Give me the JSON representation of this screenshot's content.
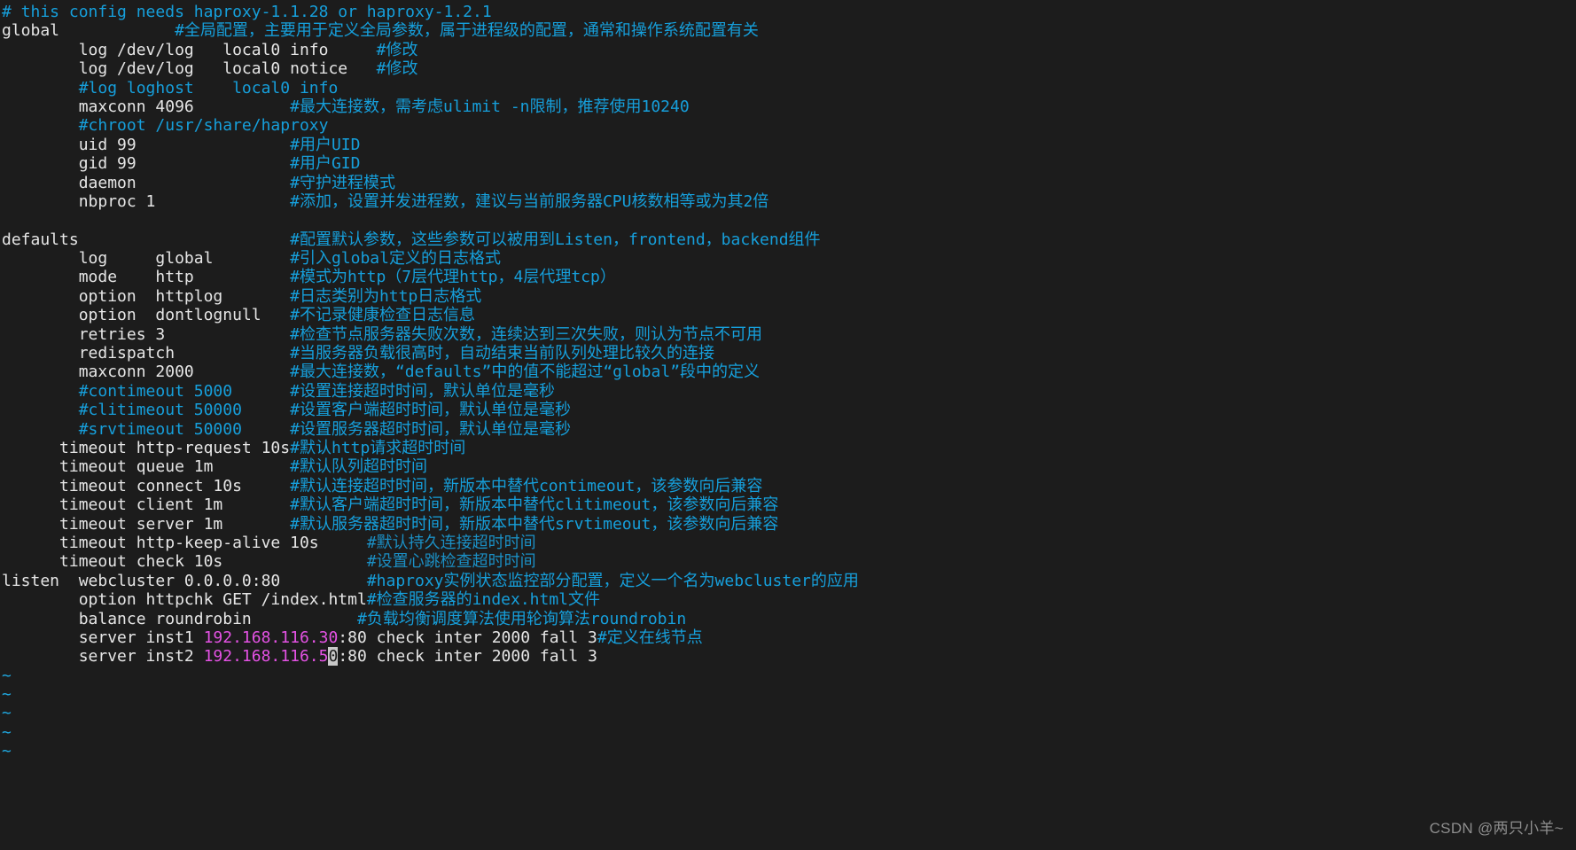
{
  "terminal": {
    "app": "vim",
    "colors": {
      "background": "#1c1c1c",
      "code_text": "#e6e6e6",
      "comment_text": "#169fdb",
      "ip_address": "#e452e4",
      "tilde": "#1fa8e0",
      "cursor_background": "#c8c8c8",
      "watermark": "#8e8e8e"
    },
    "cursor": {
      "line_index": 34,
      "character": "0",
      "on_text": "192.168.116.50"
    },
    "watermark": "CSDN @两只小羊~",
    "lines": [
      {
        "code": "",
        "comment": "# this config needs haproxy-1.1.28 or haproxy-1.2.1",
        "comment_col": 0
      },
      {
        "code": "global",
        "comment": "#全局配置，主要用于定义全局参数，属于进程级的配置，通常和操作系统配置有关",
        "comment_col": 18
      },
      {
        "code": "        log /dev/log   local0 info",
        "comment": "#修改",
        "comment_col": 39
      },
      {
        "code": "        log /dev/log   local0 notice",
        "comment": "#修改",
        "comment_col": 39
      },
      {
        "code": "        #log loghost    local0 info",
        "comment": "",
        "comment_col": 0,
        "code_is_comment": true
      },
      {
        "code": "        maxconn 4096",
        "comment": "#最大连接数，需考虑ulimit -n限制，推荐使用10240",
        "comment_col": 30
      },
      {
        "code": "        #chroot /usr/share/haproxy",
        "comment": "",
        "comment_col": 0,
        "code_is_comment": true
      },
      {
        "code": "        uid 99",
        "comment": "#用户UID",
        "comment_col": 30
      },
      {
        "code": "        gid 99",
        "comment": "#用户GID",
        "comment_col": 30
      },
      {
        "code": "        daemon",
        "comment": "#守护进程模式",
        "comment_col": 30
      },
      {
        "code": "        nbproc 1",
        "comment": "#添加，设置并发进程数，建议与当前服务器CPU核数相等或为其2倍",
        "comment_col": 30
      },
      {
        "code": "",
        "comment": "",
        "comment_col": 0
      },
      {
        "code": "defaults",
        "comment": "#配置默认参数，这些参数可以被用到Listen，frontend，backend组件",
        "comment_col": 30
      },
      {
        "code": "        log     global",
        "comment": "#引入global定义的日志格式",
        "comment_col": 30
      },
      {
        "code": "        mode    http",
        "comment": "#模式为http（7层代理http，4层代理tcp）",
        "comment_col": 30
      },
      {
        "code": "        option  httplog",
        "comment": "#日志类别为http日志格式",
        "comment_col": 30
      },
      {
        "code": "        option  dontlognull",
        "comment": "#不记录健康检查日志信息",
        "comment_col": 30
      },
      {
        "code": "        retries 3",
        "comment": "#检查节点服务器失败次数，连续达到三次失败，则认为节点不可用",
        "comment_col": 30
      },
      {
        "code": "        redispatch",
        "comment": "#当服务器负载很高时，自动结束当前队列处理比较久的连接",
        "comment_col": 30
      },
      {
        "code": "        maxconn 2000",
        "comment": "#最大连接数，“defaults”中的值不能超过“global”段中的定义",
        "comment_col": 30
      },
      {
        "code": "        #contimeout 5000",
        "comment": "#设置连接超时时间，默认单位是毫秒",
        "comment_col": 30,
        "code_is_comment": true
      },
      {
        "code": "        #clitimeout 50000",
        "comment": "#设置客户端超时时间，默认单位是毫秒",
        "comment_col": 30,
        "code_is_comment": true
      },
      {
        "code": "        #srvtimeout 50000",
        "comment": "#设置服务器超时时间，默认单位是毫秒",
        "comment_col": 30,
        "code_is_comment": true
      },
      {
        "code": "      timeout http-request 10s",
        "comment": "#默认http请求超时时间",
        "comment_col": 30
      },
      {
        "code": "      timeout queue 1m",
        "comment": "#默认队列超时时间",
        "comment_col": 30
      },
      {
        "code": "      timeout connect 10s",
        "comment": "#默认连接超时时间，新版本中替代contimeout，该参数向后兼容",
        "comment_col": 30
      },
      {
        "code": "      timeout client 1m",
        "comment": "#默认客户端超时时间，新版本中替代clitimeout，该参数向后兼容",
        "comment_col": 30
      },
      {
        "code": "      timeout server 1m",
        "comment": "#默认服务器超时时间，新版本中替代srvtimeout，该参数向后兼容",
        "comment_col": 30
      },
      {
        "code": "      timeout http-keep-alive 10s",
        "comment": "#默认持久连接超时时间",
        "comment_col": 38,
        "comment_dim": true
      },
      {
        "code": "      timeout check 10s",
        "comment": "#设置心跳检查超时时间",
        "comment_col": 38,
        "comment_dim": true
      },
      {
        "code": "listen  webcluster 0.0.0.0:80",
        "comment": "#haproxy实例状态监控部分配置，定义一个名为webcluster的应用",
        "comment_col": 38
      },
      {
        "code": "        option httpchk GET /index.html",
        "comment": "#检查服务器的index.html文件",
        "comment_col": 38
      },
      {
        "code": "        balance roundrobin",
        "comment": "#负载均衡调度算法使用轮询算法roundrobin",
        "comment_col": 37
      },
      {
        "code": "        server inst1 192.168.116.30:80 check inter 2000 fall 3",
        "comment": "#定义在线节点",
        "comment_col": 62,
        "ip": "192.168.116.30"
      },
      {
        "code": "        server inst2 192.168.116.50:80 check inter 2000 fall 3",
        "comment": "",
        "comment_col": 0,
        "ip": "192.168.116.50",
        "cursor_char": "0"
      }
    ],
    "tilde_rows": 5,
    "tilde_char": "~"
  }
}
